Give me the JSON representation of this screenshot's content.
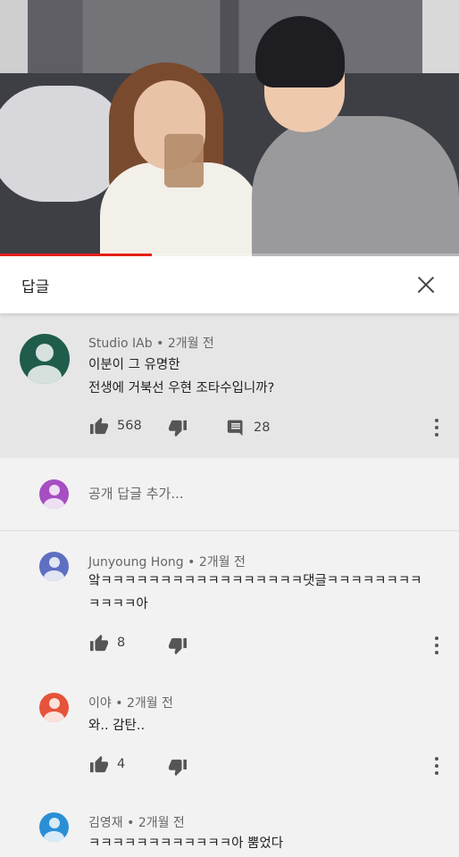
{
  "video": {
    "progress": 0.33,
    "accent_color": "#e62117"
  },
  "header": {
    "title": "답글",
    "close_icon": "close-icon"
  },
  "parent_comment": {
    "author": "Studio IAb",
    "time": "2개월 전",
    "lines": [
      "이분이 그 유명한",
      "전생에 거북선 우현 조타수입니까?"
    ],
    "likes": "568",
    "replies_count": "28",
    "avatar_color": "#1f5c4c"
  },
  "add_reply": {
    "placeholder": "공개 답글 추가...",
    "avatar_color": "#a64ec2"
  },
  "replies": [
    {
      "author": "Junyoung Hong",
      "time": "2개월 전",
      "lines": [
        "앜ㅋㅋㅋㅋㅋㅋㅋㅋㅋㅋㅋㅋㅋㅋㅋㅋㅋ댓글ㅋㅋㅋㅋㅋㅋㅋㅋ",
        "ㅋㅋㅋㅋ아"
      ],
      "likes": "8",
      "avatar_color": "#5f6fc2"
    },
    {
      "author": "이야",
      "time": "2개월 전",
      "lines": [
        "와.. 감탄.."
      ],
      "likes": "4",
      "avatar_color": "#e5533a"
    },
    {
      "author": "김영재",
      "time": "2개월 전",
      "lines": [
        "ㅋㅋㅋㅋㅋㅋㅋㅋㅋㅋㅋㅋ아 뿜었다"
      ],
      "likes": "",
      "avatar_color": "#2b8fd6"
    }
  ],
  "separator": "•",
  "icons": [
    "thumb-up-icon",
    "thumb-down-icon",
    "comment-icon",
    "more-vert-icon"
  ]
}
